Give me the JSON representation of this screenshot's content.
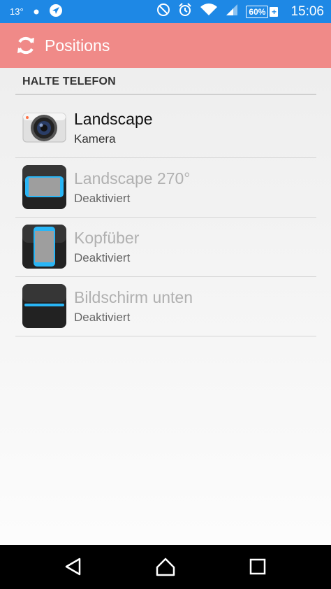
{
  "status_bar": {
    "temperature": "13°",
    "battery": "60%",
    "battery_plus": "+",
    "time": "15:06"
  },
  "app_bar": {
    "title": "Positions",
    "icon": "sync-icon",
    "color": "#f08a88"
  },
  "section": {
    "header": "HALTE TELEFON"
  },
  "positions": [
    {
      "title": "Landscape",
      "subtitle": "Kamera",
      "icon": "camera-icon",
      "enabled": true
    },
    {
      "title": "Landscape 270°",
      "subtitle": "Deaktiviert",
      "icon": "phone-landscape-icon",
      "enabled": false
    },
    {
      "title": "Kopfüber",
      "subtitle": "Deaktiviert",
      "icon": "phone-upside-down-icon",
      "enabled": false
    },
    {
      "title": "Bildschirm unten",
      "subtitle": "Deaktiviert",
      "icon": "phone-screen-down-icon",
      "enabled": false
    }
  ],
  "nav_bar": {
    "buttons": [
      "back-icon",
      "home-icon",
      "recents-icon"
    ]
  },
  "colors": {
    "status_bar": "#1e88e5",
    "accent_blue": "#29b6f6"
  }
}
